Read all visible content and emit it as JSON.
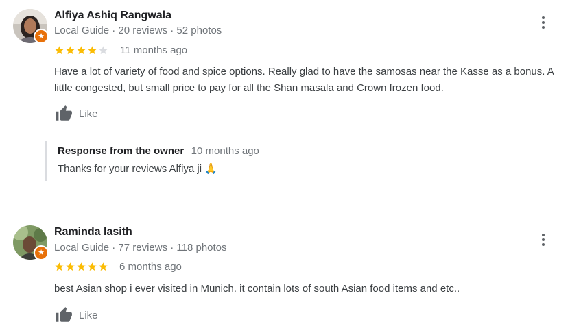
{
  "reviews": [
    {
      "name": "Alfiya Ashiq Rangwala",
      "meta": "Local Guide · 20 reviews · 52 photos",
      "rating": 4,
      "rating_max": 5,
      "date": "11 months ago",
      "text_lines": [
        "Have a lot of variety of food and spice options. Really glad to have the samosas near the Kasse as a bonus. A",
        "little congested, but small price to pay for all the Shan masala and Crown frozen food."
      ],
      "like_label": "Like",
      "owner_response": {
        "title": "Response from the owner",
        "date": "10 months ago",
        "text": "Thanks for your reviews Alfiya ji 🙏"
      }
    },
    {
      "name": "Raminda lasith",
      "meta": "Local Guide · 77 reviews · 118 photos",
      "rating": 5,
      "rating_max": 5,
      "date": "6 months ago",
      "text_lines": [
        "best Asian shop i ever visited in Munich. it contain lots of south Asian food items and etc.."
      ],
      "like_label": "Like"
    }
  ],
  "colors": {
    "star_filled": "#fbbc04",
    "star_empty": "#dadce0",
    "local_guide_badge": "#e8710a",
    "secondary_text": "#70757a"
  },
  "icons": [
    "thumbs-up-icon",
    "more-vert-icon",
    "star-icon",
    "local-guide-badge-icon"
  ]
}
